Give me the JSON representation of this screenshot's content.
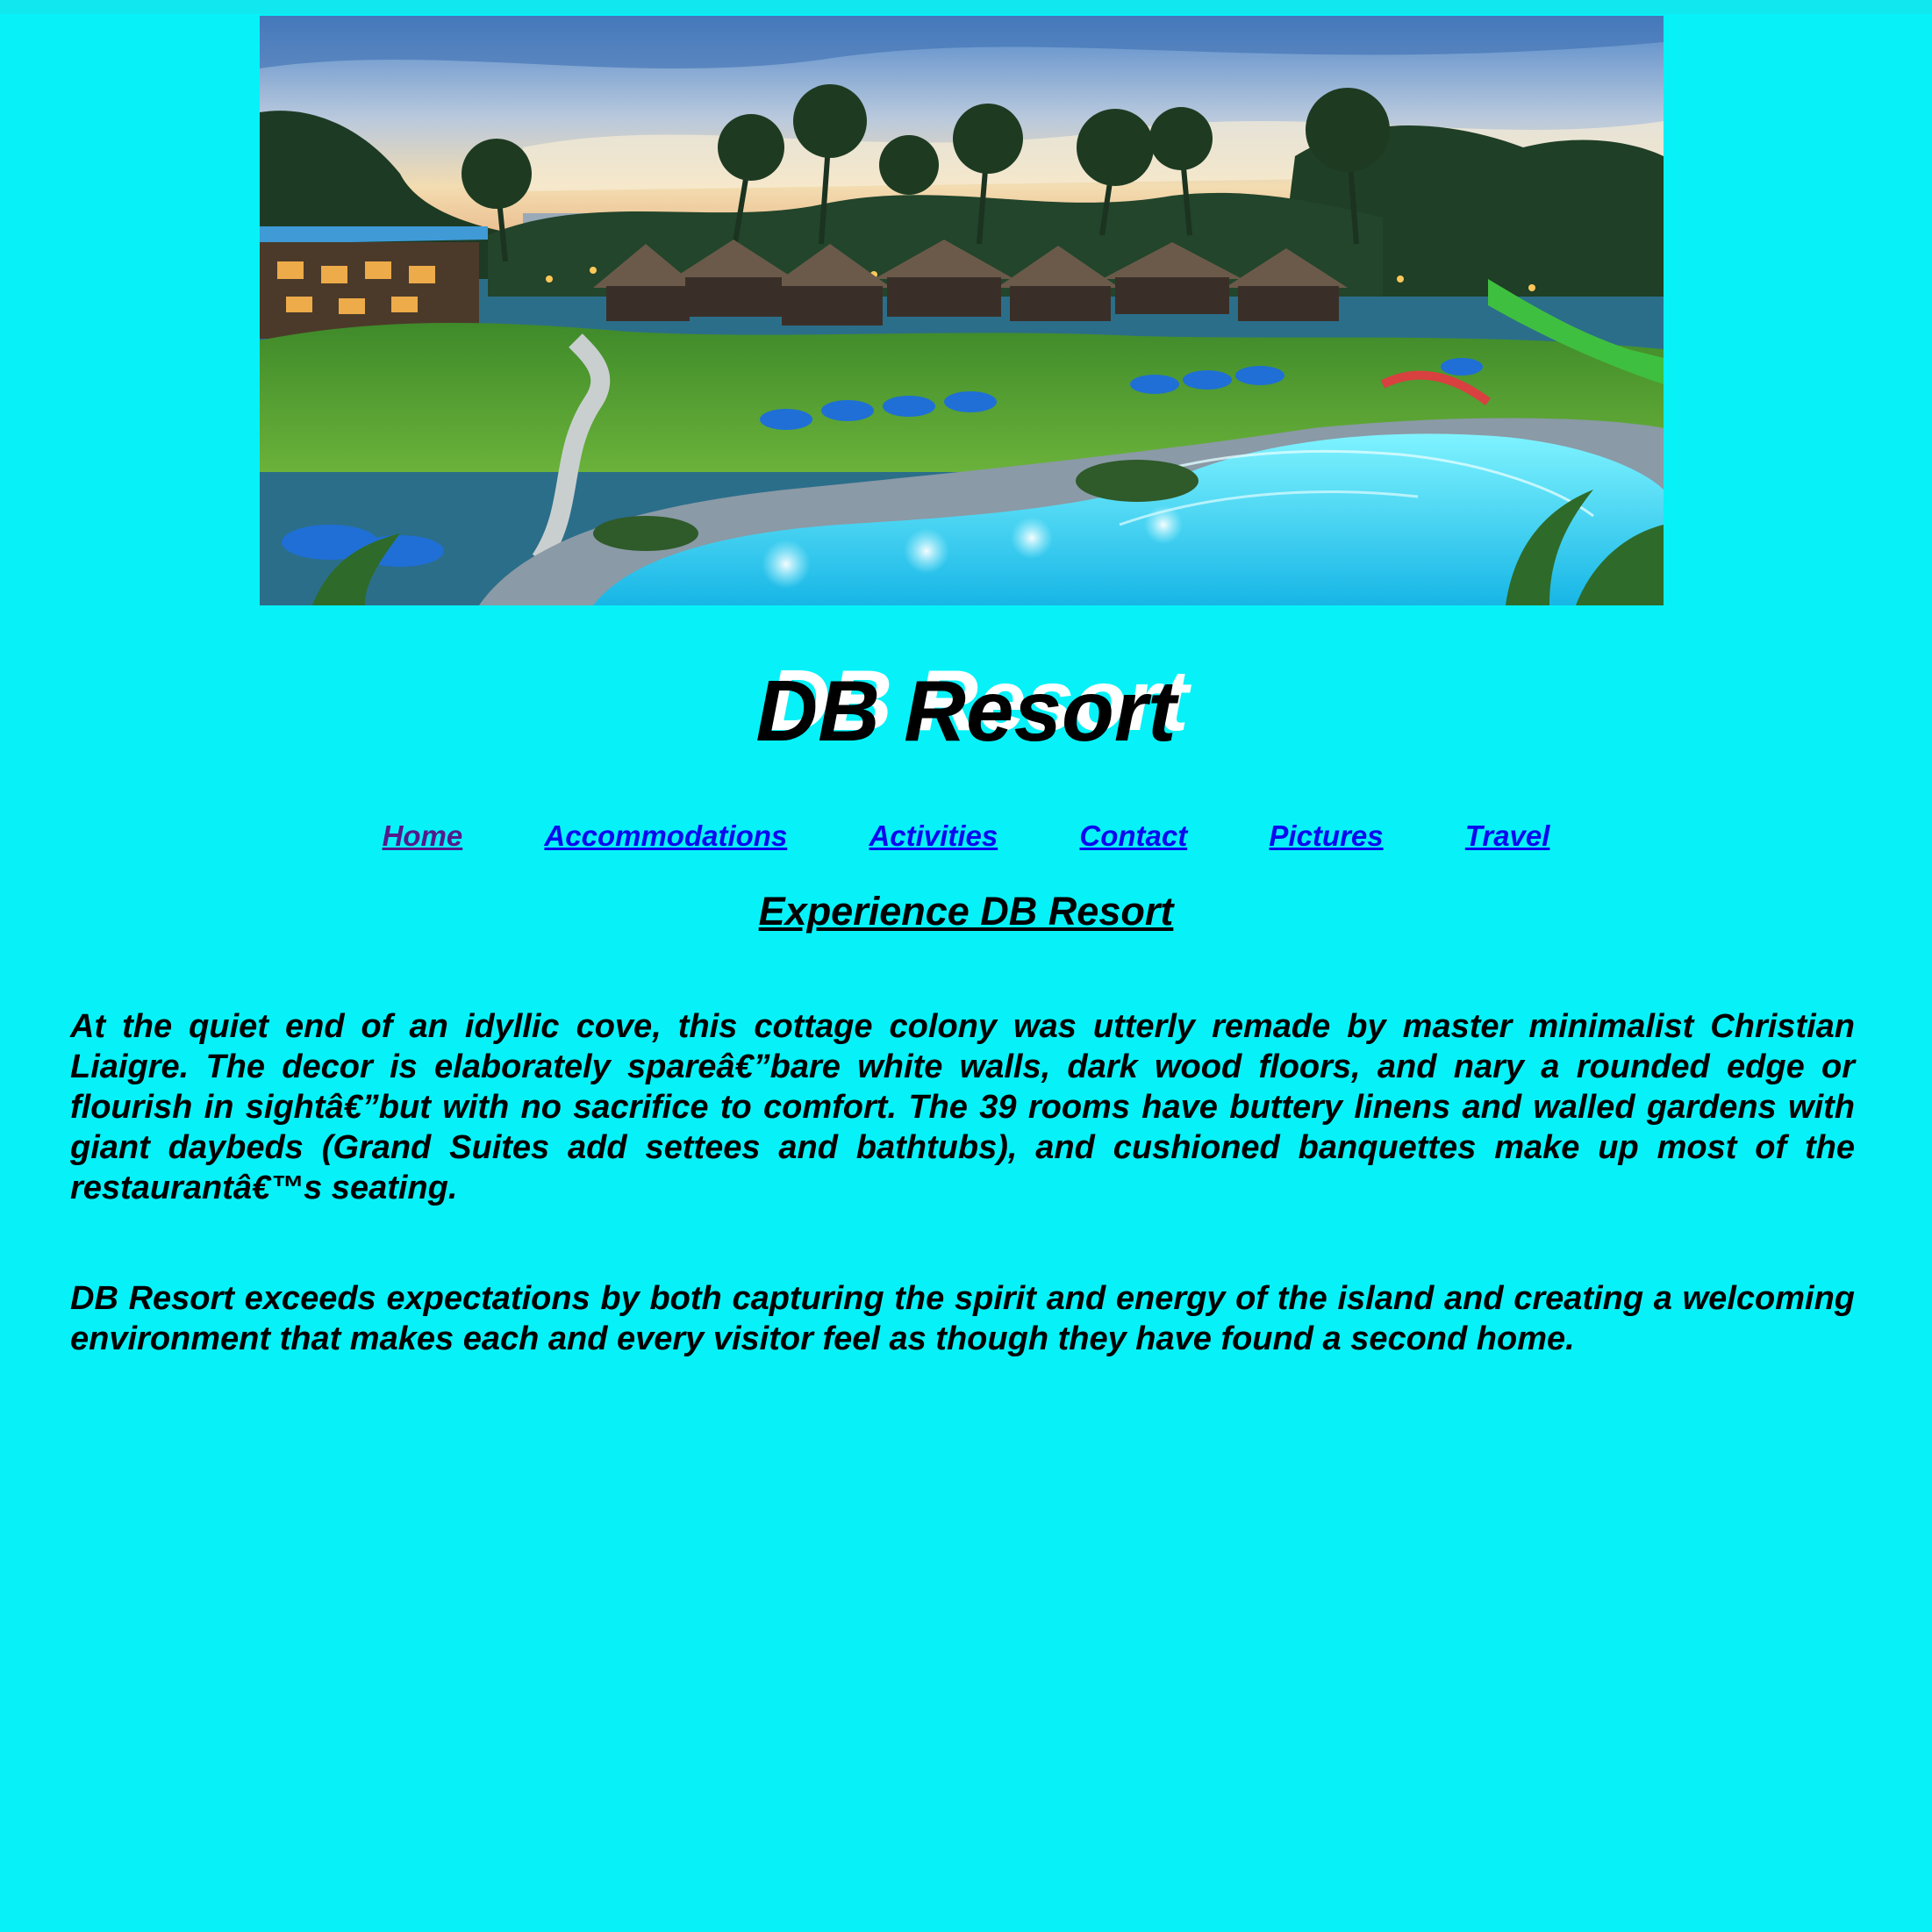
{
  "site": {
    "title": "DB Resort",
    "title_shadow": "DB Resort"
  },
  "banner": {
    "alt": "Resort pool and grounds at dusk"
  },
  "nav": {
    "items": [
      {
        "label": "Home",
        "visited": true
      },
      {
        "label": "Accommodations",
        "visited": false
      },
      {
        "label": "Activities",
        "visited": false
      },
      {
        "label": "Contact",
        "visited": false
      },
      {
        "label": "Pictures",
        "visited": false
      },
      {
        "label": "Travel",
        "visited": false
      }
    ]
  },
  "content": {
    "heading": "Experience DB Resort",
    "paragraph_1": "At the quiet end of an idyllic cove, this cottage colony was utterly remade by master minimalist Christian Liaigre. The decor is elaborately spareâ€”bare white walls, dark wood floors, and nary a rounded edge or flourish in sightâ€”but with no sacrifice to comfort. The 39 rooms have buttery linens and walled gardens with giant daybeds (Grand Suites add settees and bathtubs), and cushioned banquettes make up most of the restaurantâ€™s seating.",
    "paragraph_2": "DB Resort exceeds expectations by both capturing the spirit and energy of the island and creating a welcoming environment that makes each and every visitor feel as though they have found a second home."
  },
  "colors": {
    "background": "#06f2f8",
    "link": "#0a0aee",
    "link_visited": "#551a8b",
    "title_shadow": "#ffffff"
  }
}
